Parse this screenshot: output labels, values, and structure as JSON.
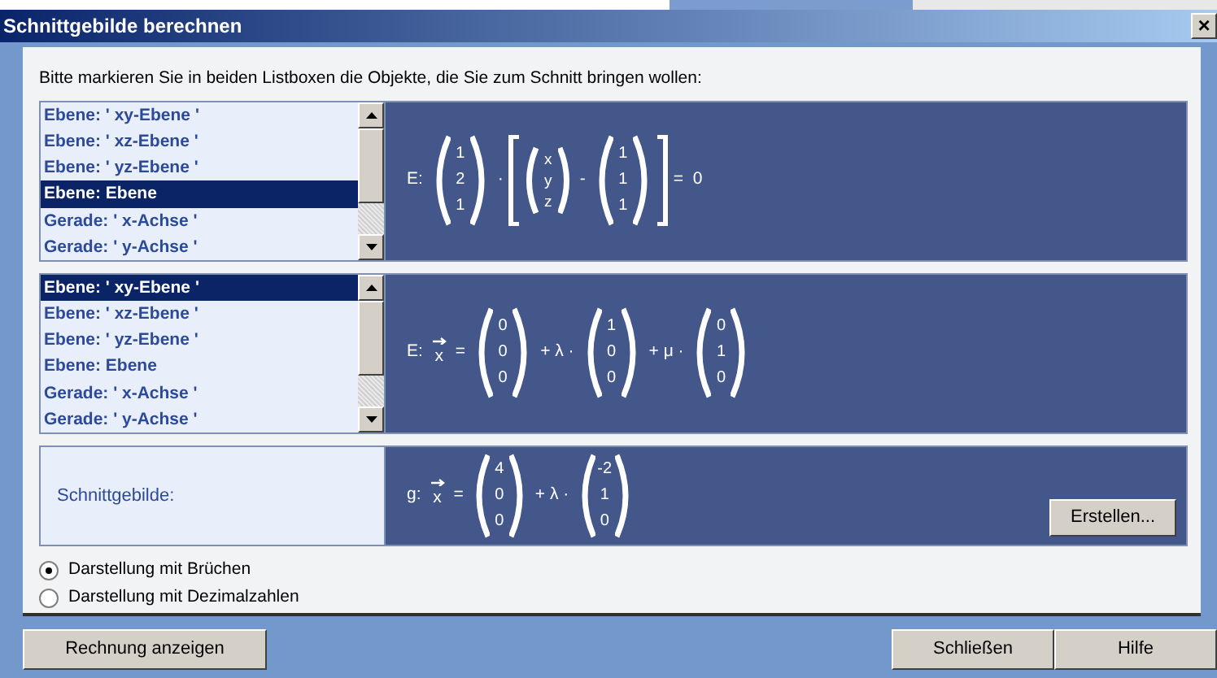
{
  "window": {
    "title": "Schnittgebilde berechnen",
    "close": "×"
  },
  "instruction": "Bitte markieren Sie in beiden Listboxen die Objekte, die Sie zum Schnitt bringen wollen:",
  "selectors": [
    {
      "items": [
        {
          "label": "Ebene: ' xy-Ebene '",
          "selected": false
        },
        {
          "label": "Ebene: ' xz-Ebene '",
          "selected": false
        },
        {
          "label": "Ebene: ' yz-Ebene '",
          "selected": false
        },
        {
          "label": "Ebene: Ebene",
          "selected": true
        },
        {
          "label": "Gerade: ' x-Achse '",
          "selected": false
        },
        {
          "label": "Gerade: ' y-Achse '",
          "selected": false
        }
      ],
      "formula": [
        {
          "kind": "text",
          "text": "E:"
        },
        {
          "kind": "vector",
          "values": [
            "1",
            "2",
            "1"
          ]
        },
        {
          "kind": "text",
          "text": "·"
        },
        {
          "kind": "open_bracket"
        },
        {
          "kind": "vector",
          "small": true,
          "values": [
            "x",
            "y",
            "z"
          ]
        },
        {
          "kind": "text",
          "text": "-"
        },
        {
          "kind": "vector",
          "values": [
            "1",
            "1",
            "1"
          ]
        },
        {
          "kind": "close_bracket"
        },
        {
          "kind": "text",
          "text": "=  0"
        }
      ]
    },
    {
      "items": [
        {
          "label": "Ebene: ' xy-Ebene '",
          "selected": true
        },
        {
          "label": "Ebene: ' xz-Ebene '",
          "selected": false
        },
        {
          "label": "Ebene: ' yz-Ebene '",
          "selected": false
        },
        {
          "label": "Ebene: Ebene",
          "selected": false
        },
        {
          "label": "Gerade: ' x-Achse '",
          "selected": false
        },
        {
          "label": "Gerade: ' y-Achse '",
          "selected": false
        }
      ],
      "formula": [
        {
          "kind": "text",
          "text": "E:"
        },
        {
          "kind": "vecvar",
          "text": "x"
        },
        {
          "kind": "text",
          "text": "="
        },
        {
          "kind": "vector",
          "values": [
            "0",
            "0",
            "0"
          ]
        },
        {
          "kind": "text",
          "text": "+ λ ·"
        },
        {
          "kind": "vector",
          "values": [
            "1",
            "0",
            "0"
          ]
        },
        {
          "kind": "text",
          "text": "+ μ ·"
        },
        {
          "kind": "vector",
          "values": [
            "0",
            "1",
            "0"
          ]
        }
      ]
    }
  ],
  "result": {
    "label": "Schnittgebilde:",
    "formula": [
      {
        "kind": "text",
        "text": "g:"
      },
      {
        "kind": "vecvar",
        "text": "x"
      },
      {
        "kind": "text",
        "text": "="
      },
      {
        "kind": "vector",
        "values": [
          "4",
          "0",
          "0"
        ]
      },
      {
        "kind": "text",
        "text": "+ λ ·"
      },
      {
        "kind": "vector",
        "values": [
          "-2",
          "1",
          "0"
        ]
      }
    ],
    "button": "Erstellen..."
  },
  "display_options": [
    {
      "label": "Darstellung mit Brüchen",
      "selected": true
    },
    {
      "label": "Darstellung mit Dezimalzahlen",
      "selected": false
    }
  ],
  "footer": {
    "left_buttons": [
      "Rechnung anzeigen"
    ],
    "right_buttons": [
      "Schließen",
      "Hilfe"
    ]
  }
}
